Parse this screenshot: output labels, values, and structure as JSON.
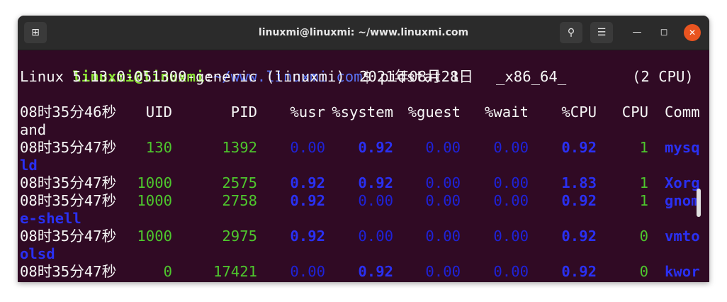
{
  "window": {
    "title": "linuxmi@linuxmi: ~/www.linuxmi.com",
    "new_tab_icon": "new-tab-icon",
    "search_icon": "search-icon",
    "menu_icon": "menu-icon",
    "minimize_icon": "minimize-icon",
    "maximize_icon": "maximize-icon",
    "close_icon": "close-icon"
  },
  "prompt": {
    "user_host": "linuxmi@linuxmi",
    "colon": ":",
    "path": "~/www.linuxmi.com",
    "dollar": "$",
    "command": " pidstat 1"
  },
  "sysinfo": {
    "kernel": "Linux 5.13.0-051300-generic (linuxmi)",
    "date": "2021年08月28日",
    "arch": "_x86_64_",
    "cpus": "(2 CPU)"
  },
  "headers": {
    "time": "08时35分46秒",
    "uid": "UID",
    "pid": "PID",
    "usr": "%usr",
    "system": "%system",
    "guest": "%guest",
    "wait": "%wait",
    "cpu_pct": "%CPU",
    "cpu": "CPU",
    "comm_a": "Comm",
    "comm_b": "and"
  },
  "rows": [
    {
      "time": "08时35分47秒",
      "uid": "130",
      "pid": "1392",
      "usr": "0.00",
      "system": "0.92",
      "guest": "0.00",
      "wait": "0.00",
      "cpu_pct": "0.92",
      "cpu": "1",
      "comm_a": "mysq",
      "comm_b": "ld"
    },
    {
      "time": "08时35分47秒",
      "uid": "1000",
      "pid": "2575",
      "usr": "0.92",
      "system": "0.92",
      "guest": "0.00",
      "wait": "0.00",
      "cpu_pct": "1.83",
      "cpu": "1",
      "comm_a": "Xorg",
      "comm_b": ""
    },
    {
      "time": "08时35分47秒",
      "uid": "1000",
      "pid": "2758",
      "usr": "0.92",
      "system": "0.00",
      "guest": "0.00",
      "wait": "0.00",
      "cpu_pct": "0.92",
      "cpu": "1",
      "comm_a": "gnom",
      "comm_b": "e-shell"
    },
    {
      "time": "08时35分47秒",
      "uid": "1000",
      "pid": "2975",
      "usr": "0.92",
      "system": "0.00",
      "guest": "0.00",
      "wait": "0.00",
      "cpu_pct": "0.92",
      "cpu": "0",
      "comm_a": "vmto",
      "comm_b": "olsd"
    },
    {
      "time": "08时35分47秒",
      "uid": "0",
      "pid": "17421",
      "usr": "0.00",
      "system": "0.92",
      "guest": "0.00",
      "wait": "0.00",
      "cpu_pct": "0.92",
      "cpu": "0",
      "comm_a": "kwor",
      "comm_b": ""
    }
  ],
  "colors": {
    "terminal_bg": "#300a24",
    "titlebar_bg": "#2b2b2b",
    "green": "#4ec72d",
    "blue": "#1f22d8",
    "close": "#e95420"
  }
}
